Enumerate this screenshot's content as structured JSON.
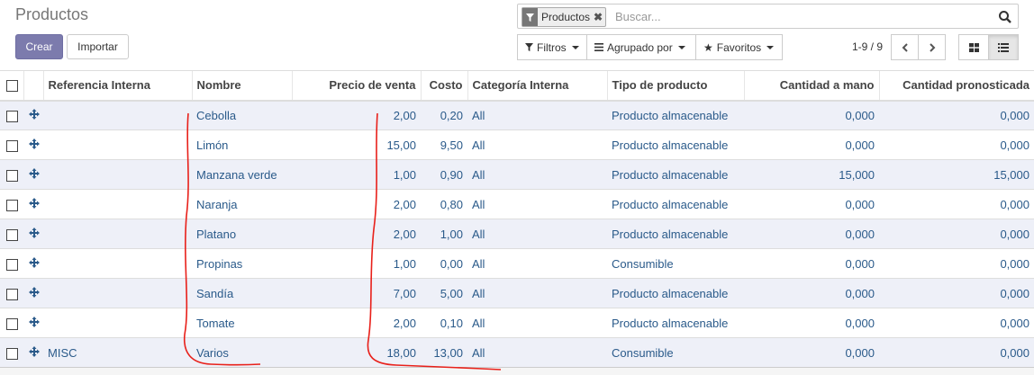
{
  "page": {
    "title": "Productos"
  },
  "buttons": {
    "create": "Crear",
    "import": "Importar"
  },
  "search": {
    "facet_label": "Productos",
    "placeholder": "Buscar...",
    "remove_icon": "close-icon",
    "facet_icon": "filter-icon",
    "search_icon": "search-icon"
  },
  "filters": {
    "filters": "Filtros",
    "group_by": "Agrupado por",
    "favorites": "Favoritos"
  },
  "pager": {
    "value": "1-9 / 9"
  },
  "views": {
    "active": "list",
    "options": [
      "kanban",
      "list"
    ]
  },
  "colors": {
    "primary": "#7c7bad",
    "link": "#2a5a8a",
    "stripe": "#eef0f8",
    "annotation": "#e8201a"
  },
  "table": {
    "headers": {
      "ref": "Referencia Interna",
      "name": "Nombre",
      "price": "Precio de venta",
      "cost": "Costo",
      "category": "Categoría Interna",
      "type": "Tipo de producto",
      "qty_hand": "Cantidad a mano",
      "qty_forecast": "Cantidad pronosticada"
    },
    "rows": [
      {
        "ref": "",
        "name": "Cebolla",
        "price": "2,00",
        "cost": "0,20",
        "category": "All",
        "type": "Producto almacenable",
        "qty_hand": "0,000",
        "qty_forecast": "0,000"
      },
      {
        "ref": "",
        "name": "Limón",
        "price": "15,00",
        "cost": "9,50",
        "category": "All",
        "type": "Producto almacenable",
        "qty_hand": "0,000",
        "qty_forecast": "0,000"
      },
      {
        "ref": "",
        "name": "Manzana verde",
        "price": "1,00",
        "cost": "0,90",
        "category": "All",
        "type": "Producto almacenable",
        "qty_hand": "15,000",
        "qty_forecast": "15,000"
      },
      {
        "ref": "",
        "name": "Naranja",
        "price": "2,00",
        "cost": "0,80",
        "category": "All",
        "type": "Producto almacenable",
        "qty_hand": "0,000",
        "qty_forecast": "0,000"
      },
      {
        "ref": "",
        "name": "Platano",
        "price": "2,00",
        "cost": "1,00",
        "category": "All",
        "type": "Producto almacenable",
        "qty_hand": "0,000",
        "qty_forecast": "0,000"
      },
      {
        "ref": "",
        "name": "Propinas",
        "price": "1,00",
        "cost": "0,00",
        "category": "All",
        "type": "Consumible",
        "qty_hand": "0,000",
        "qty_forecast": "0,000"
      },
      {
        "ref": "",
        "name": "Sandía",
        "price": "7,00",
        "cost": "5,00",
        "category": "All",
        "type": "Producto almacenable",
        "qty_hand": "0,000",
        "qty_forecast": "0,000"
      },
      {
        "ref": "",
        "name": "Tomate",
        "price": "2,00",
        "cost": "0,10",
        "category": "All",
        "type": "Producto almacenable",
        "qty_hand": "0,000",
        "qty_forecast": "0,000"
      },
      {
        "ref": "MISC",
        "name": "Varios",
        "price": "18,00",
        "cost": "13,00",
        "category": "All",
        "type": "Consumible",
        "qty_hand": "0,000",
        "qty_forecast": "0,000"
      }
    ]
  }
}
